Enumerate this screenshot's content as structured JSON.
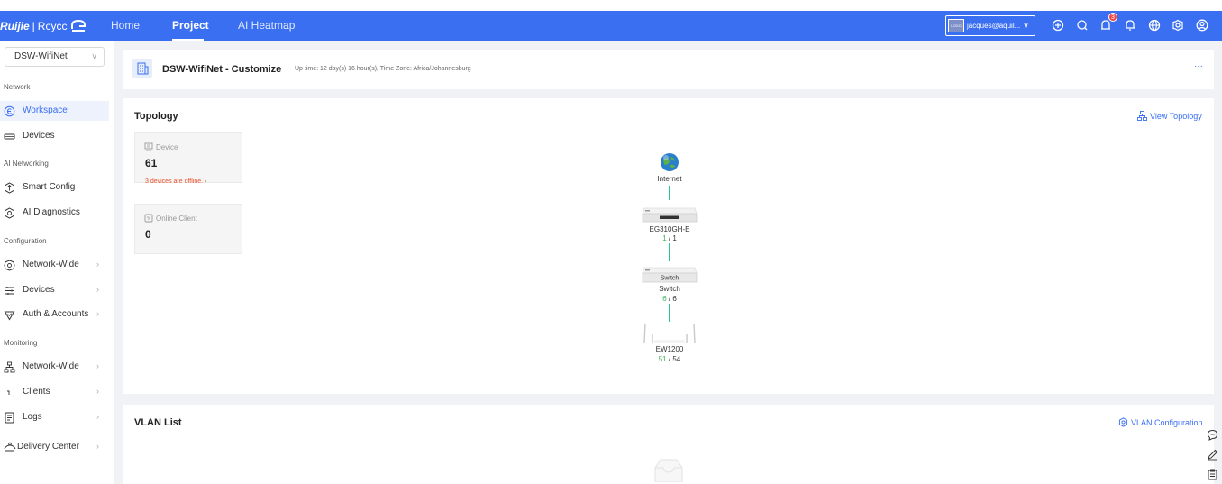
{
  "brand": {
    "ruijie": "Ruijie",
    "sep": "|",
    "reyee": "Rcycc"
  },
  "nav": {
    "home": "Home",
    "project": "Project",
    "heatmap": "AI Heatmap"
  },
  "user": {
    "logo_text": "LOGO",
    "name": "jacques@aquil...",
    "notification_count": "3"
  },
  "sidebar": {
    "network_select": "DSW-WifiNet",
    "sections": {
      "network": "Network",
      "ai_networking": "AI Networking",
      "configuration": "Configuration",
      "monitoring": "Monitoring"
    },
    "items": [
      {
        "label": "Workspace",
        "icon": "workspace-icon"
      },
      {
        "label": "Devices",
        "icon": "device-icon"
      },
      {
        "label": "Smart Config",
        "icon": "smart-config-icon"
      },
      {
        "label": "AI Diagnostics",
        "icon": "diagnostics-icon"
      },
      {
        "label": "Network-Wide",
        "icon": "network-wide-icon"
      },
      {
        "label": "Devices",
        "icon": "devices-config-icon"
      },
      {
        "label": "Auth & Accounts",
        "icon": "auth-icon"
      },
      {
        "label": "Network-Wide",
        "icon": "topology-icon"
      },
      {
        "label": "Clients",
        "icon": "clients-icon"
      },
      {
        "label": "Logs",
        "icon": "logs-icon"
      },
      {
        "label": "Delivery Center",
        "icon": "delivery-icon"
      }
    ]
  },
  "header": {
    "title": "DSW-WifiNet - Customize",
    "subtitle": "Up time: 12 day(s) 16 hour(s), Time Zone: Africa/Johannesburg",
    "more": "···"
  },
  "topology": {
    "title": "Topology",
    "view_link": "View Topology",
    "device_label": "Device",
    "device_count": "61",
    "offline_text": "3 devices are offline.",
    "client_label": "Online Client",
    "client_count": "0",
    "nodes": [
      {
        "name": "Internet"
      },
      {
        "name": "EG310GH-E",
        "online": "1",
        "sep": "/",
        "total": "1",
        "face": "EG310GH-E"
      },
      {
        "name": "Switch",
        "online": "6",
        "sep": "/",
        "total": "6",
        "face": "Switch"
      },
      {
        "name": "EW1200",
        "online": "51",
        "sep": "/",
        "total": "54"
      }
    ]
  },
  "vlan": {
    "title": "VLAN List",
    "config_link": "VLAN Configuration"
  },
  "colors": {
    "primary": "#3a6ff2",
    "link_line": "#28c49a",
    "warn": "#e9542e",
    "online": "#3eb05a"
  }
}
